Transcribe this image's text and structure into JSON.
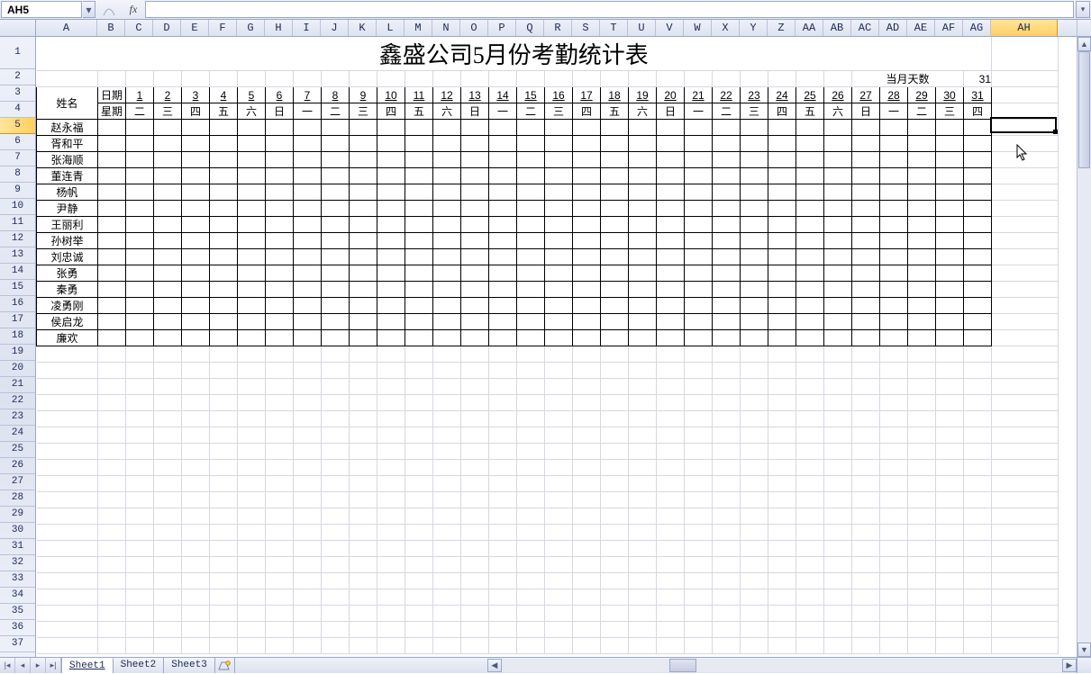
{
  "name_box": "AH5",
  "fx_label": "fx",
  "formula_value": "",
  "columns_single": [
    "A"
  ],
  "columns_narrow": [
    "B",
    "C",
    "D",
    "E",
    "F",
    "G",
    "H",
    "I",
    "J",
    "K",
    "L",
    "M",
    "N",
    "O",
    "P",
    "Q",
    "R",
    "S",
    "T",
    "U",
    "V",
    "W",
    "X",
    "Y",
    "Z",
    "AA",
    "AB",
    "AC",
    "AD",
    "AE",
    "AF",
    "AG"
  ],
  "selected_col": "AH",
  "col_A_width": 68,
  "col_narrow_width": 31,
  "col_AH_width": 74,
  "title": "鑫盛公司5月份考勤统计表",
  "month_days_label": "当月天数",
  "month_days_value": "31",
  "name_header": "姓名",
  "date_label": "日期",
  "week_label": "星期",
  "dates": [
    "1",
    "2",
    "3",
    "4",
    "5",
    "6",
    "7",
    "8",
    "9",
    "10",
    "11",
    "12",
    "13",
    "14",
    "15",
    "16",
    "17",
    "18",
    "19",
    "20",
    "21",
    "22",
    "23",
    "24",
    "25",
    "26",
    "27",
    "28",
    "29",
    "30",
    "31"
  ],
  "weekdays": [
    "二",
    "三",
    "四",
    "五",
    "六",
    "日",
    "一",
    "二",
    "三",
    "四",
    "五",
    "六",
    "日",
    "一",
    "二",
    "三",
    "四",
    "五",
    "六",
    "日",
    "一",
    "二",
    "三",
    "四",
    "五",
    "六",
    "日",
    "一",
    "二",
    "三",
    "四"
  ],
  "names": [
    "赵永福",
    "胥和平",
    "张海顺",
    "董连青",
    "杨帆",
    "尹静",
    "王丽利",
    "孙树举",
    "刘忠诚",
    "张勇",
    "秦勇",
    "凌勇刚",
    "侯启龙",
    "廉欢"
  ],
  "row_headers_tall": [
    1
  ],
  "row_header_count": 37,
  "selected_row": 5,
  "tabs": [
    "Sheet1",
    "Sheet2",
    "Sheet3"
  ],
  "active_tab": 0
}
